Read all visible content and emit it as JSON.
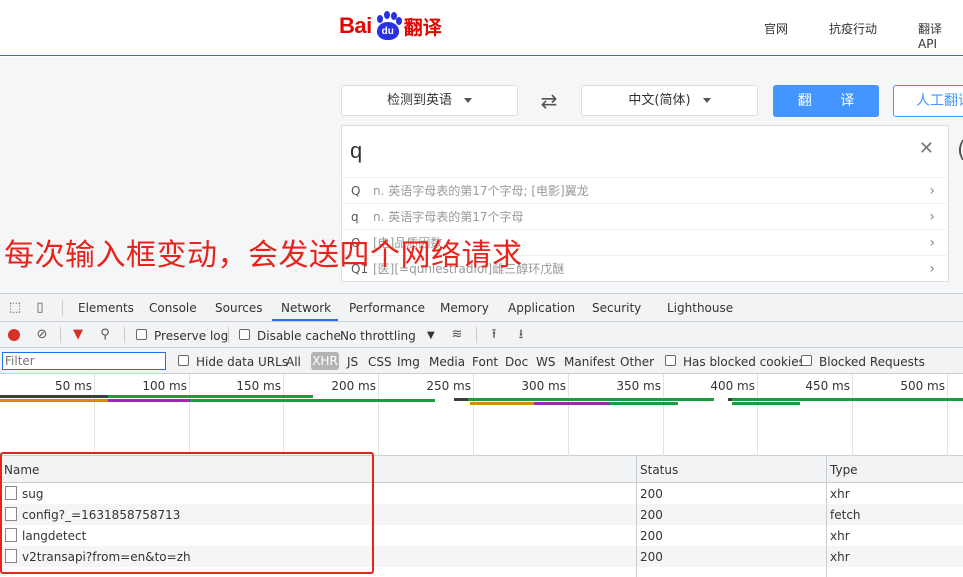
{
  "header": {
    "logo_bai": "Bai",
    "logo_du": "du",
    "logo_fanyi": "翻译",
    "nav": [
      "官网",
      "抗疫行动",
      "翻译 API"
    ]
  },
  "translate": {
    "source_lang": "检测到英语",
    "target_lang": "中文(简体)",
    "translate_button": "翻 译",
    "human_button": "人工翻译",
    "query": "q",
    "suggestions": [
      {
        "key": "Q",
        "text": "n. 英语字母表的第17个字母; [电影]翼龙"
      },
      {
        "key": "q",
        "text": "n. 英语字母表的第17个字母"
      },
      {
        "key": "Q",
        "text": "[电]品质因数"
      },
      {
        "key": "Q1",
        "text": "[医][=quniestradiol]雌三醇环戊醚"
      }
    ]
  },
  "annotation": "每次输入框变动，会发送四个网络请求",
  "devtools": {
    "tabs": [
      "Elements",
      "Console",
      "Sources",
      "Network",
      "Performance",
      "Memory",
      "Application",
      "Security",
      "Lighthouse"
    ],
    "active_tab": "Network",
    "toolbar": {
      "preserve_log": "Preserve log",
      "disable_cache": "Disable cache",
      "throttling": "No throttling"
    },
    "filter": {
      "placeholder": "Filter",
      "hide_data_urls": "Hide data URLs",
      "types": [
        "All",
        "XHR",
        "JS",
        "CSS",
        "Img",
        "Media",
        "Font",
        "Doc",
        "WS",
        "Manifest",
        "Other"
      ],
      "selected_type": "XHR",
      "has_blocked_cookies": "Has blocked cookies",
      "blocked_requests": "Blocked Requests"
    },
    "timeline_ticks": [
      "50 ms",
      "100 ms",
      "150 ms",
      "200 ms",
      "250 ms",
      "300 ms",
      "350 ms",
      "400 ms",
      "450 ms",
      "500 ms"
    ],
    "columns": [
      "Name",
      "Status",
      "Type"
    ],
    "requests": [
      {
        "name": "sug",
        "status": "200",
        "type": "xhr"
      },
      {
        "name": "config?_=1631858758713",
        "status": "200",
        "type": "fetch"
      },
      {
        "name": "langdetect",
        "status": "200",
        "type": "xhr"
      },
      {
        "name": "v2transapi?from=en&to=zh",
        "status": "200",
        "type": "xhr"
      }
    ]
  },
  "colors": {
    "brand_red": "#e10601",
    "brand_blue": "#2932e1",
    "translate_btn": "#4395ff",
    "annotation_red": "#e8231b",
    "devtools_accent": "#1a73e8"
  }
}
